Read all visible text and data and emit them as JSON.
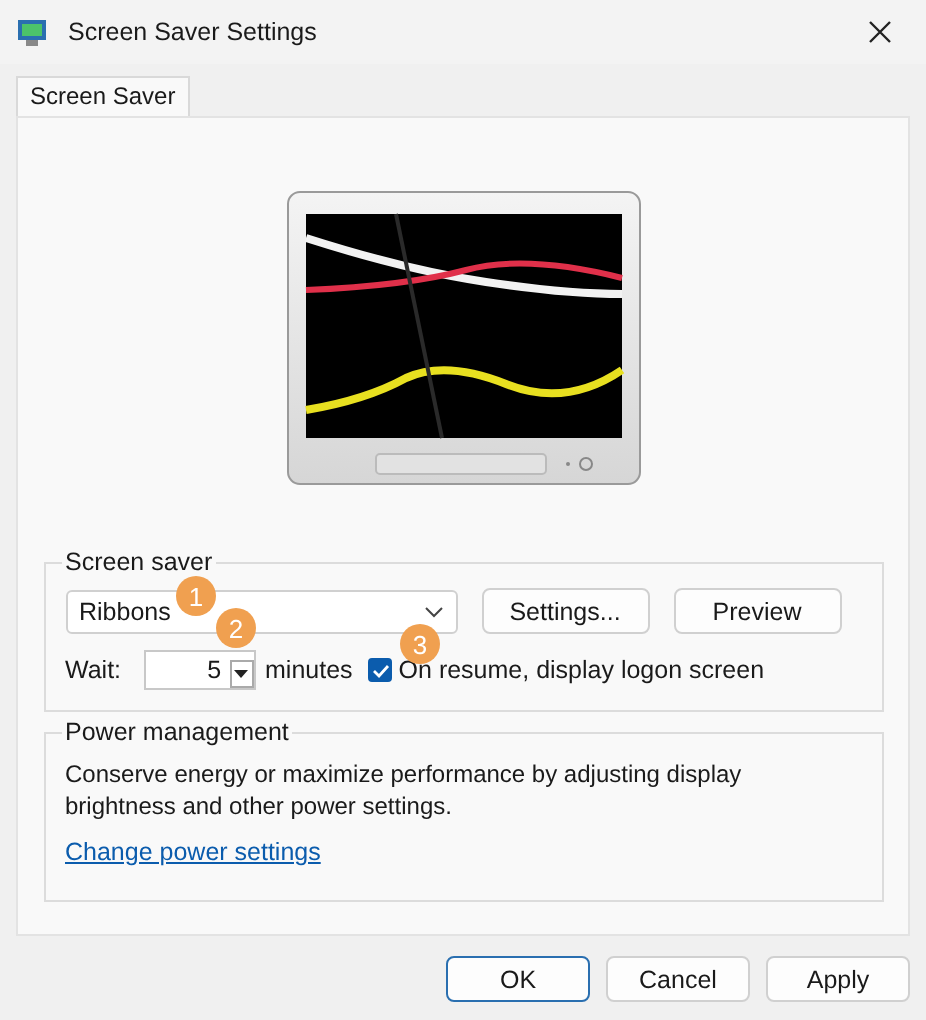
{
  "window": {
    "title": "Screen Saver Settings"
  },
  "tabs": [
    {
      "label": "Screen Saver",
      "selected": true
    }
  ],
  "screen_saver": {
    "legend": "Screen saver",
    "dropdown": {
      "value": "Ribbons"
    },
    "buttons": [
      "Settings...",
      "Preview"
    ],
    "wait_label": "Wait:",
    "wait_value": "5",
    "units": "minutes",
    "logon": {
      "label": "On resume, display logon screen",
      "checked": true
    }
  },
  "power": {
    "legend": "Power management",
    "description": "Conserve energy or maximize performance by adjusting display brightness and other power settings.",
    "link": "Change power settings"
  },
  "callouts": [
    "1",
    "2",
    "3"
  ],
  "buttons": [
    {
      "label": "OK",
      "default": true
    },
    {
      "label": "Cancel",
      "default": false
    },
    {
      "label": "Apply",
      "default": false
    }
  ]
}
